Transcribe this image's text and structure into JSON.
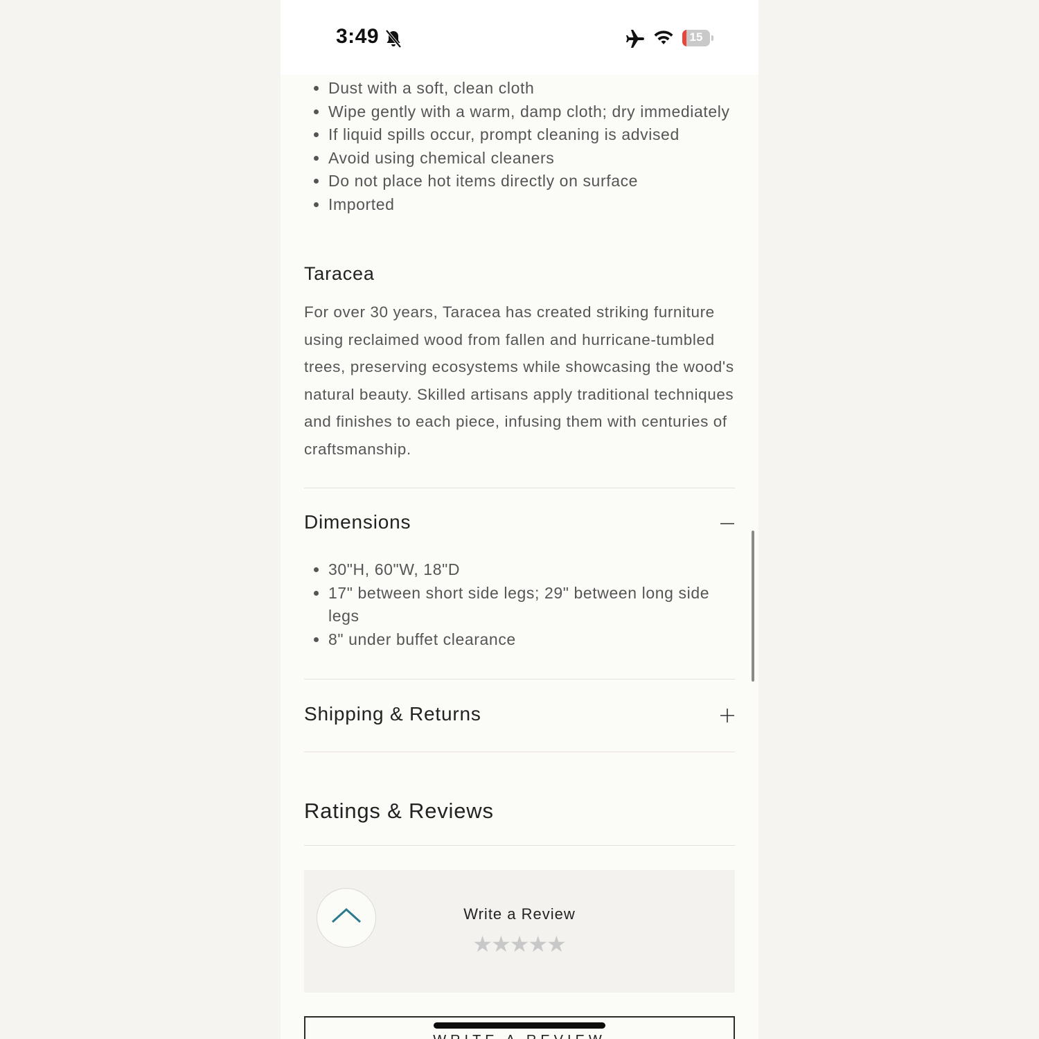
{
  "status_bar": {
    "time": "3:49",
    "battery_level": "15",
    "colors": {
      "battery_low": "#e8453c"
    },
    "icons": [
      "bell-slash-icon",
      "airplane-icon",
      "wifi-icon",
      "battery-icon"
    ]
  },
  "care": {
    "items": [
      "Dust with a soft, clean cloth",
      "Wipe gently with a warm, damp cloth; dry immediately",
      "If liquid spills occur, prompt cleaning is advised",
      "Avoid using chemical cleaners",
      "Do not place hot items directly on surface",
      "Imported"
    ]
  },
  "brand": {
    "title": "Taracea",
    "description": "For over 30 years, Taracea has created striking furniture using reclaimed wood from fallen and hurricane-tumbled trees, preserving ecosystems while showcasing the wood's natural beauty. Skilled artisans apply traditional techniques and finishes to each piece, infusing them with centuries of craftsmanship."
  },
  "dimensions": {
    "title": "Dimensions",
    "expanded": true,
    "toggle_icon": "minus-icon",
    "items": [
      "30\"H, 60\"W, 18\"D",
      "17\" between short side legs; 29\" between long side legs",
      "8\" under buffet clearance"
    ]
  },
  "shipping": {
    "title": "Shipping & Returns",
    "expanded": false,
    "toggle_icon": "plus-icon"
  },
  "ratings": {
    "title": "Ratings & Reviews",
    "write_review_label": "Write a Review",
    "stars": [
      "★",
      "★",
      "★",
      "★",
      "★"
    ],
    "star_rating": 0,
    "button_label": "WRITE A REVIEW"
  }
}
